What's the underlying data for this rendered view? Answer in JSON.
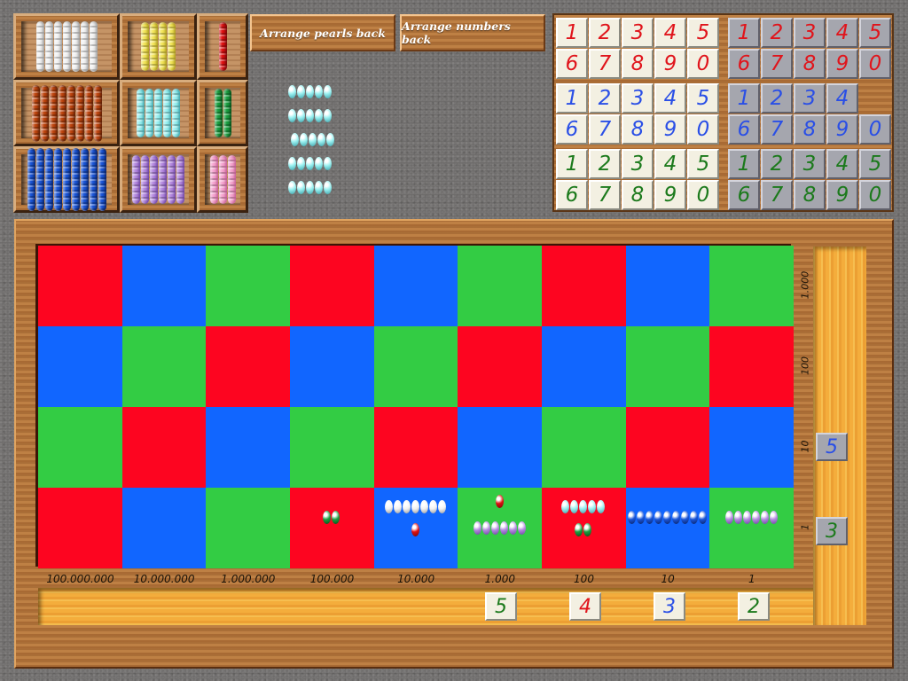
{
  "colors": {
    "red": "#fd0520",
    "blue": "#1166ff",
    "green": "#33cc44"
  },
  "toolbar": {
    "arrange_pearls_label": "Arrange pearls back",
    "arrange_numbers_label": "Arrange numbers back"
  },
  "bead_shelf": [
    {
      "name": "white",
      "value": 7,
      "color": "#f2f2f2",
      "dark": "#9a9a9a"
    },
    {
      "name": "yellow",
      "value": 4,
      "color": "#f4e65a",
      "dark": "#a8961a"
    },
    {
      "name": "red",
      "value": 1,
      "color": "#e01010",
      "dark": "#700808"
    },
    {
      "name": "brown",
      "value": 8,
      "color": "#c0450e",
      "dark": "#5a1e04"
    },
    {
      "name": "light-blue",
      "value": 5,
      "color": "#9af0f0",
      "dark": "#3aa0a8"
    },
    {
      "name": "green",
      "value": 2,
      "color": "#1aa040",
      "dark": "#0a4818"
    },
    {
      "name": "dark-blue",
      "value": 9,
      "color": "#1a55d8",
      "dark": "#0a2060"
    },
    {
      "name": "lavender",
      "value": 6,
      "color": "#b58ae0",
      "dark": "#6a40a0"
    },
    {
      "name": "pink",
      "value": 3,
      "color": "#f6a6d0",
      "dark": "#c05a90"
    }
  ],
  "loose_beads": {
    "color": "#9af0f0",
    "dark": "#3aa0a8",
    "bars": [
      5,
      5,
      5,
      5,
      5
    ]
  },
  "card_sets": [
    {
      "color": "red",
      "style": "cream",
      "digits": [
        "1",
        "2",
        "3",
        "4",
        "5",
        "6",
        "7",
        "8",
        "9",
        "0"
      ]
    },
    {
      "color": "red",
      "style": "grey",
      "digits": [
        "1",
        "2",
        "3",
        "4",
        "5",
        "6",
        "7",
        "8",
        "9",
        "0"
      ]
    },
    {
      "color": "blue",
      "style": "cream",
      "digits": [
        "1",
        "2",
        "3",
        "4",
        "5",
        "6",
        "7",
        "8",
        "9",
        "0"
      ]
    },
    {
      "color": "blue",
      "style": "grey",
      "digits": [
        "1",
        "2",
        "3",
        "4",
        "",
        "6",
        "7",
        "8",
        "9",
        "0"
      ]
    },
    {
      "color": "green",
      "style": "cream",
      "digits": [
        "1",
        "2",
        "3",
        "4",
        "5",
        "6",
        "7",
        "8",
        "9",
        "0"
      ]
    },
    {
      "color": "green",
      "style": "grey",
      "digits": [
        "1",
        "2",
        "3",
        "4",
        "5",
        "6",
        "7",
        "8",
        "9",
        "0"
      ]
    }
  ],
  "board": {
    "column_labels": [
      "100.000.000",
      "10.000.000",
      "1.000.000",
      "100.000",
      "10.000",
      "1.000",
      "100",
      "10",
      "1"
    ],
    "row_labels": [
      "1.000",
      "100",
      "10",
      "1"
    ],
    "cell_colors": [
      [
        "R",
        "B",
        "G",
        "R",
        "B",
        "G",
        "R",
        "B",
        "G"
      ],
      [
        "B",
        "G",
        "R",
        "B",
        "G",
        "R",
        "B",
        "G",
        "R"
      ],
      [
        "G",
        "R",
        "B",
        "G",
        "R",
        "B",
        "G",
        "R",
        "B"
      ],
      [
        "R",
        "B",
        "G",
        "R",
        "B",
        "G",
        "R",
        "B",
        "G"
      ]
    ],
    "bottom_row_beads": [
      [],
      [],
      [],
      [
        {
          "bar": 2,
          "color": "#1aa040",
          "dark": "#0a4818"
        }
      ],
      [
        {
          "bar": 7,
          "color": "#f2f2f2",
          "dark": "#9a9a9a"
        },
        {
          "bar": 1,
          "color": "#e01010",
          "dark": "#700808"
        }
      ],
      [
        {
          "bar": 1,
          "color": "#e01010",
          "dark": "#700808"
        },
        {
          "bar": 6,
          "color": "#b58ae0",
          "dark": "#6a40a0"
        }
      ],
      [
        {
          "bar": 5,
          "color": "#9af0f0",
          "dark": "#3aa0a8"
        },
        {
          "bar": 2,
          "color": "#1aa040",
          "dark": "#0a4818"
        }
      ],
      [
        {
          "bar": 9,
          "color": "#1a55d8",
          "dark": "#0a2060"
        }
      ],
      [
        {
          "bar": 6,
          "color": "#b58ae0",
          "dark": "#6a40a0"
        }
      ]
    ],
    "placed_bottom_cards": [
      {
        "digit": "5",
        "color": "green",
        "style": "cream"
      },
      {
        "digit": "4",
        "color": "red",
        "style": "cream"
      },
      {
        "digit": "3",
        "color": "blue",
        "style": "cream"
      },
      {
        "digit": "2",
        "color": "green",
        "style": "cream"
      }
    ],
    "placed_right_cards": [
      {
        "digit": "5",
        "color": "blue",
        "style": "grey",
        "row": "10"
      },
      {
        "digit": "3",
        "color": "green",
        "style": "grey",
        "row": "1"
      }
    ]
  }
}
